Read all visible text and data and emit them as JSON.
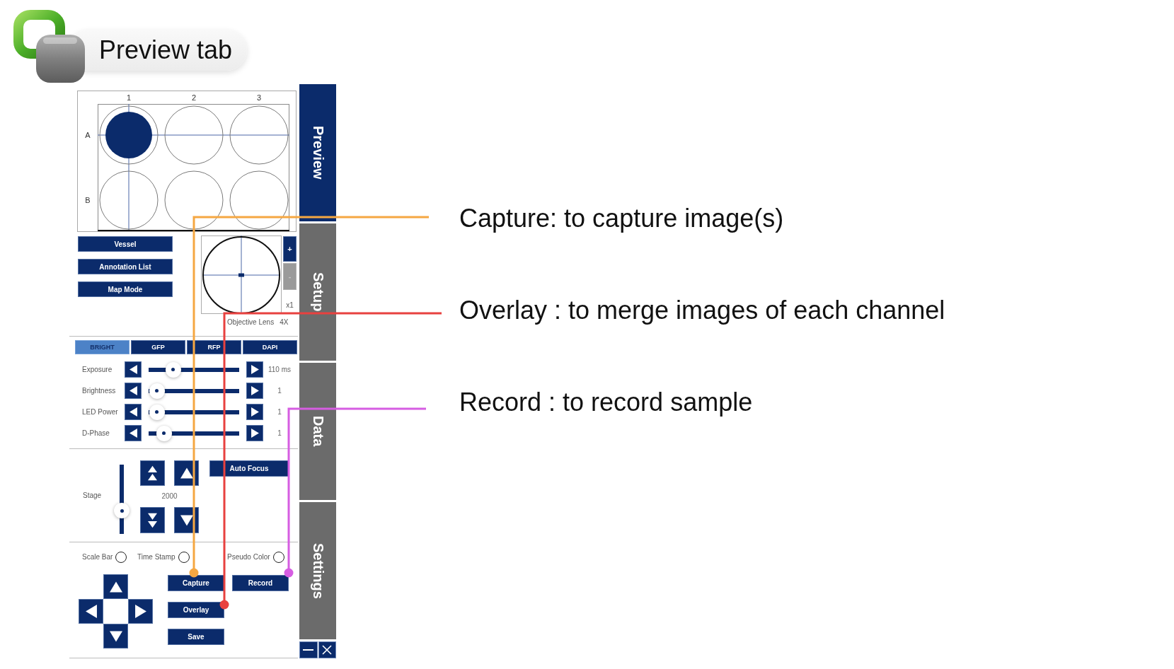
{
  "header": {
    "title": "Preview tab"
  },
  "app": {
    "well_plate": {
      "column_labels": [
        "1",
        "2",
        "3"
      ],
      "rows": [
        {
          "label": "A",
          "wells": [
            {
              "selected": true
            },
            {
              "selected": false
            },
            {
              "selected": false
            }
          ]
        },
        {
          "label": "B",
          "wells": [
            {
              "selected": false
            },
            {
              "selected": false
            },
            {
              "selected": false
            }
          ]
        }
      ]
    },
    "panel_buttons": [
      "Vessel",
      "Annotation List",
      "Map Mode"
    ],
    "objective": {
      "zoom_in": {
        "label": "+",
        "disabled": false
      },
      "zoom_out": {
        "label": "-",
        "disabled": true
      },
      "magnification": "x1",
      "label": "Objective Lens",
      "lens": "4X"
    },
    "channel_tabs": [
      {
        "label": "BRIGHT",
        "selected": true
      },
      {
        "label": "GFP",
        "selected": false
      },
      {
        "label": "RFP",
        "selected": false
      },
      {
        "label": "DAPI",
        "selected": false
      }
    ],
    "sliders": [
      {
        "label": "Exposure",
        "level": 0.27,
        "reading": "110 ms"
      },
      {
        "label": "Brightness",
        "level": 0.09,
        "reading": "1"
      },
      {
        "label": "LED Power",
        "level": 0.09,
        "reading": "1"
      },
      {
        "label": "D-Phase",
        "level": 0.17,
        "reading": "1"
      }
    ],
    "stage": {
      "label": "Stage",
      "level": 0.34,
      "value": "2000",
      "auto_focus": "Auto Focus"
    },
    "options": [
      {
        "label": "Scale Bar",
        "checked": false
      },
      {
        "label": "Time Stamp",
        "checked": false
      },
      {
        "label": "Pseudo Color",
        "checked": false
      }
    ],
    "actions": [
      [
        "Capture",
        "Record"
      ],
      [
        "Overlay"
      ],
      [
        "Save"
      ]
    ],
    "side_tabs": [
      {
        "label": "Preview",
        "selected": true
      },
      {
        "label": "Setup",
        "selected": false
      },
      {
        "label": "Data",
        "selected": false
      },
      {
        "label": "Settings",
        "selected": false
      }
    ]
  },
  "annotations": [
    {
      "text": "Capture: to capture image(s)",
      "color": "#f5a742"
    },
    {
      "text": "Overlay : to merge images of each channel",
      "color": "#e8413f"
    },
    {
      "text": "Record : to record sample",
      "color": "#d65de2"
    }
  ]
}
